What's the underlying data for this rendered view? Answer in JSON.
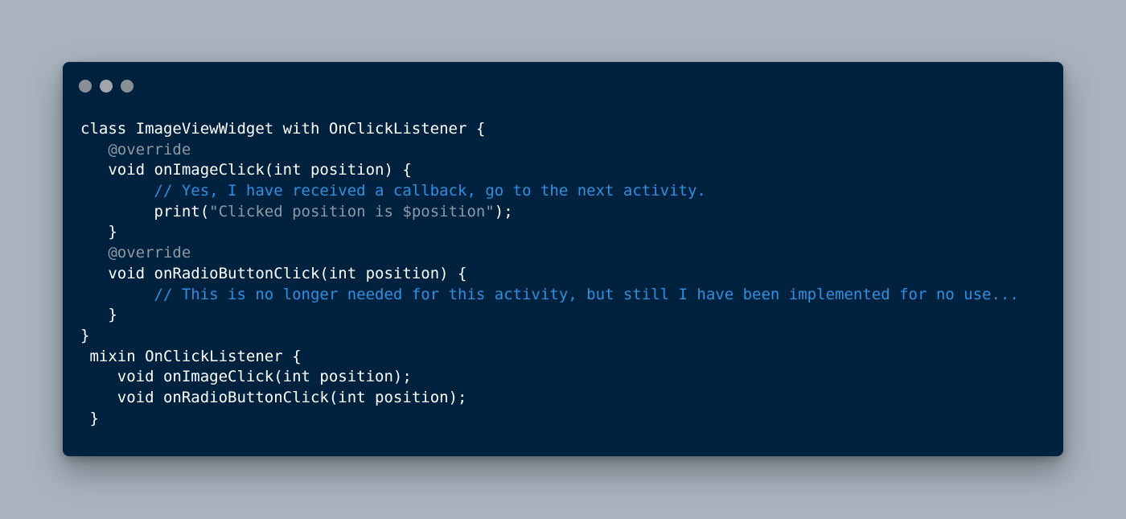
{
  "window": {
    "controls": [
      "window-dot-icon",
      "window-dot-icon",
      "window-dot-icon"
    ],
    "colors": {
      "page_background": "#a9b3bf",
      "window_background": "#00223f",
      "text": "#ffffff",
      "annotation": "#8e98a4",
      "comment": "#2f8fe0",
      "string": "#8e98a4"
    }
  },
  "code": {
    "lines": [
      {
        "indent": "",
        "segments": [
          {
            "type": "tx",
            "text": "class ImageViewWidget with OnClickListener {"
          }
        ]
      },
      {
        "indent": "   ",
        "segments": [
          {
            "type": "ann",
            "text": "@override"
          }
        ]
      },
      {
        "indent": "   ",
        "segments": [
          {
            "type": "tx",
            "text": "void onImageClick(int position) {"
          }
        ]
      },
      {
        "indent": "        ",
        "segments": [
          {
            "type": "cmt",
            "text": "// Yes, I have received a callback, go to the next activity."
          }
        ]
      },
      {
        "indent": "        ",
        "segments": [
          {
            "type": "tx",
            "text": "print("
          },
          {
            "type": "str",
            "text": "\"Clicked position is $position\""
          },
          {
            "type": "tx",
            "text": ");"
          }
        ]
      },
      {
        "indent": "   ",
        "segments": [
          {
            "type": "tx",
            "text": "}"
          }
        ]
      },
      {
        "indent": "   ",
        "segments": [
          {
            "type": "ann",
            "text": "@override"
          }
        ]
      },
      {
        "indent": "   ",
        "segments": [
          {
            "type": "tx",
            "text": "void onRadioButtonClick(int position) {"
          }
        ]
      },
      {
        "indent": "        ",
        "segments": [
          {
            "type": "cmt",
            "text": "// This is no longer needed for this activity, but still I have been implemented for no use..."
          }
        ]
      },
      {
        "indent": "   ",
        "segments": [
          {
            "type": "tx",
            "text": "}"
          }
        ]
      },
      {
        "indent": "",
        "segments": [
          {
            "type": "tx",
            "text": "}"
          }
        ]
      },
      {
        "indent": " ",
        "segments": [
          {
            "type": "tx",
            "text": "mixin OnClickListener {"
          }
        ]
      },
      {
        "indent": "    ",
        "segments": [
          {
            "type": "tx",
            "text": "void onImageClick(int position);"
          }
        ]
      },
      {
        "indent": "    ",
        "segments": [
          {
            "type": "tx",
            "text": "void onRadioButtonClick(int position);"
          }
        ]
      },
      {
        "indent": " ",
        "segments": [
          {
            "type": "tx",
            "text": "}"
          }
        ]
      }
    ]
  }
}
